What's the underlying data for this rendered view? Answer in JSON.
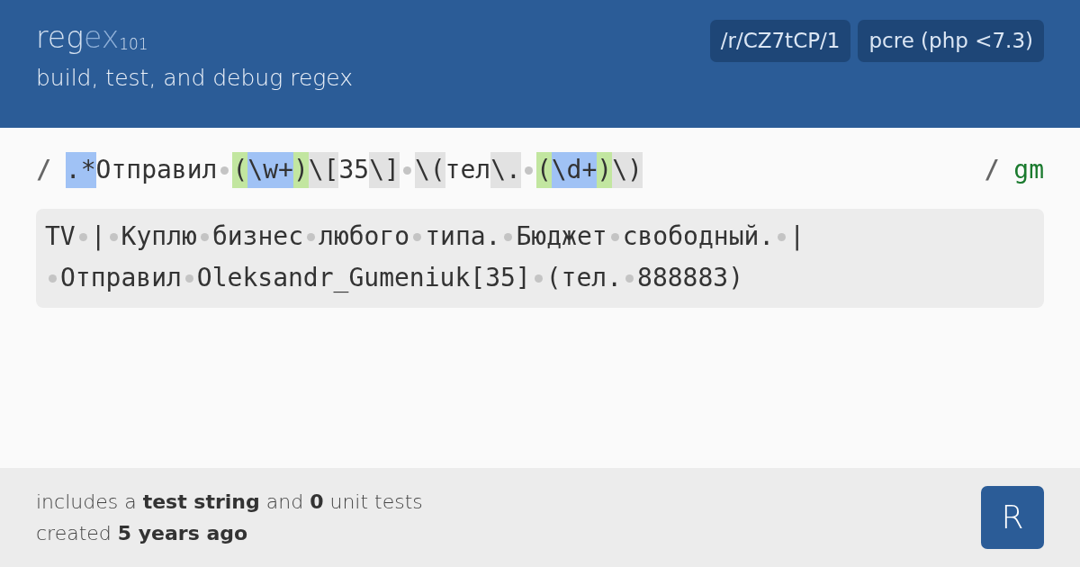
{
  "header": {
    "logo": {
      "part_a": "reg",
      "part_b": "ex",
      "subscript": "101"
    },
    "tagline": "build, test, and debug regex",
    "badges": [
      "/r/CZ7tCP/1",
      "pcre (php <7.3)"
    ]
  },
  "regex": {
    "open_delimiter": "/",
    "close_delimiter": "/",
    "flags": "gm",
    "tokens": [
      {
        "kind": "quantifier",
        "text": ".*"
      },
      {
        "kind": "plain",
        "text": "Отправил"
      },
      {
        "kind": "space"
      },
      {
        "kind": "group",
        "text": "("
      },
      {
        "kind": "quantifier",
        "text": "\\w+"
      },
      {
        "kind": "group",
        "text": ")"
      },
      {
        "kind": "escape",
        "text": "\\["
      },
      {
        "kind": "plain",
        "text": "35"
      },
      {
        "kind": "escape",
        "text": "\\]"
      },
      {
        "kind": "space"
      },
      {
        "kind": "escape",
        "text": "\\("
      },
      {
        "kind": "plain",
        "text": "тел"
      },
      {
        "kind": "escape",
        "text": "\\."
      },
      {
        "kind": "space"
      },
      {
        "kind": "group",
        "text": "("
      },
      {
        "kind": "quantifier",
        "text": "\\d+"
      },
      {
        "kind": "group",
        "text": ")"
      },
      {
        "kind": "escape",
        "text": "\\)"
      }
    ]
  },
  "test_string": {
    "lines": [
      [
        {
          "kind": "text",
          "text": "TV"
        },
        {
          "kind": "space"
        },
        {
          "kind": "text",
          "text": "|"
        },
        {
          "kind": "space"
        },
        {
          "kind": "text",
          "text": "Куплю"
        },
        {
          "kind": "space"
        },
        {
          "kind": "text",
          "text": "бизнес"
        },
        {
          "kind": "space"
        },
        {
          "kind": "text",
          "text": "любого"
        },
        {
          "kind": "space"
        },
        {
          "kind": "text",
          "text": "типа."
        },
        {
          "kind": "space"
        },
        {
          "kind": "text",
          "text": "Бюджет"
        },
        {
          "kind": "space"
        },
        {
          "kind": "text",
          "text": "свободный."
        },
        {
          "kind": "space"
        },
        {
          "kind": "text",
          "text": "|"
        }
      ],
      [
        {
          "kind": "space"
        },
        {
          "kind": "text",
          "text": "Отправил"
        },
        {
          "kind": "space"
        },
        {
          "kind": "text",
          "text": "Oleksandr_Gumeniuk[35]"
        },
        {
          "kind": "space"
        },
        {
          "kind": "text",
          "text": "(тел."
        },
        {
          "kind": "space"
        },
        {
          "kind": "text",
          "text": "888883)"
        }
      ]
    ]
  },
  "footer": {
    "lines": [
      "includes a **test string** and **0** unit tests",
      "created **5 years ago**"
    ],
    "avatar_letter": "R"
  }
}
